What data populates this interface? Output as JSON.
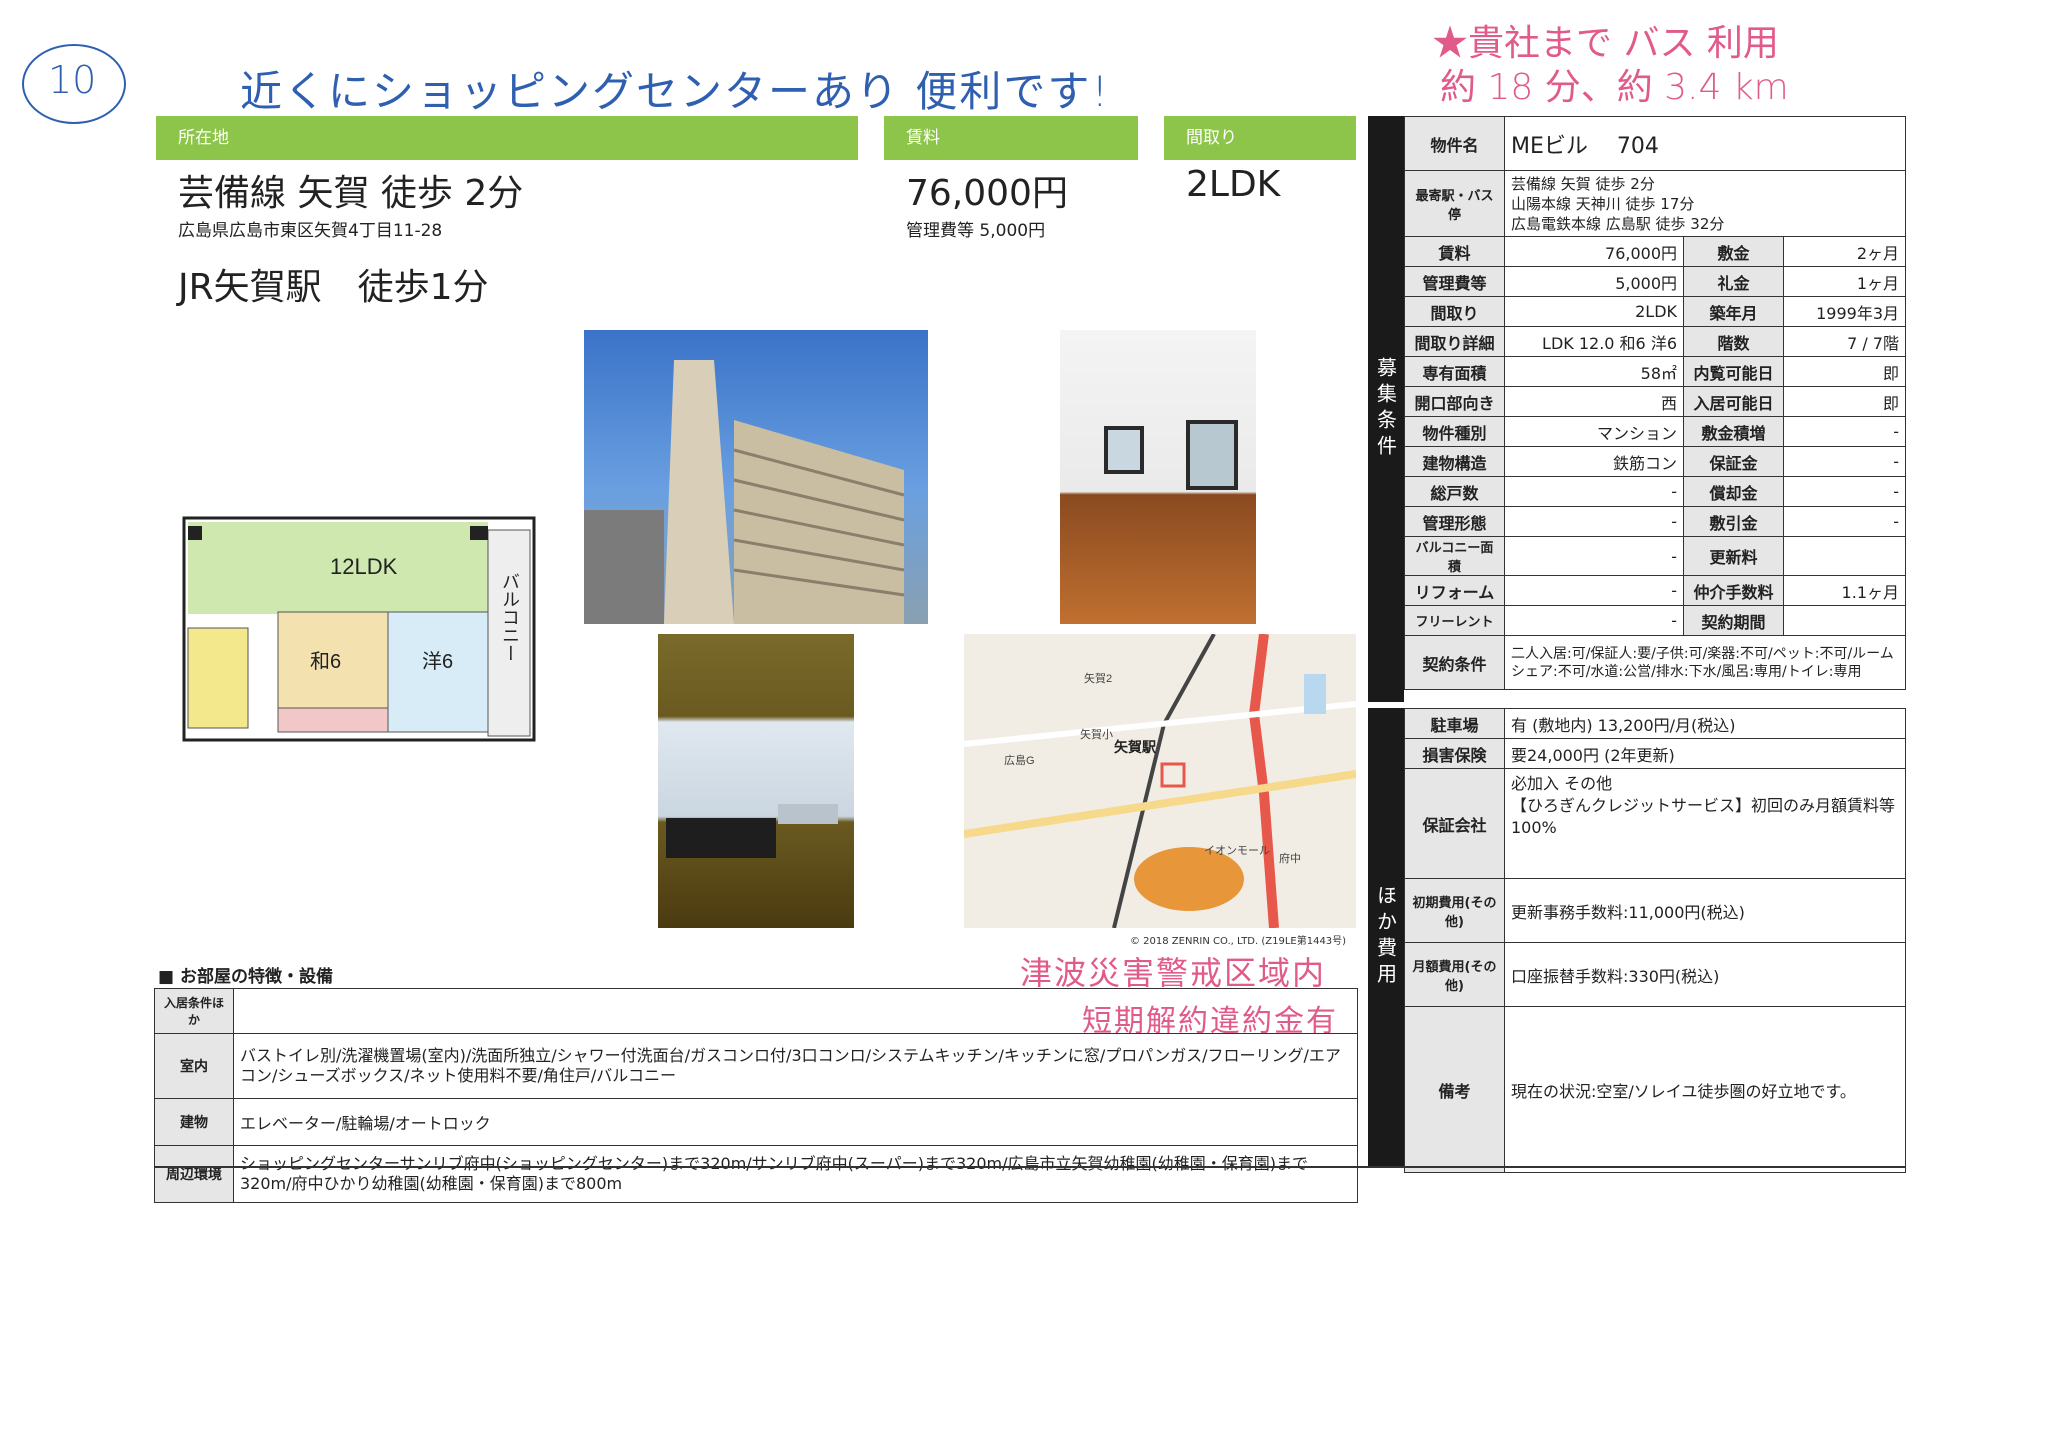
{
  "handwriting": {
    "number": "10",
    "note": "近くにショッピングセンターあり 便利です!",
    "bus_line1": "★貴社まで バス 利用",
    "bus_line2": "約 18 分、約 3.4 km"
  },
  "summary": {
    "location_header": "所在地",
    "location_main": "芸備線 矢賀 徒歩 2分",
    "address": "広島県広島市東区矢賀4丁目11-28",
    "station_note": "JR矢賀駅　徒歩1分",
    "rent_header": "賃料",
    "rent_main": "76,000円",
    "mgmt_fee": "管理費等 5,000円",
    "layout_header": "間取り",
    "layout_main": "2LDK"
  },
  "floorplan": {
    "ldk": "12LDK",
    "wa": "和6",
    "yo": "洋6",
    "balcony": "バルコニー"
  },
  "map": {
    "station": "矢賀駅",
    "labels": [
      "矢賀2",
      "矢賀小",
      "広島G",
      "イオンモール",
      "府中"
    ],
    "copyright": "© 2018 ZENRIN CO., LTD. (Z19LE第1443号)"
  },
  "spec": {
    "property_name_label": "物件名",
    "property_name": "MEビル　 704",
    "nearest_label": "最寄駅・バス停",
    "nearest": [
      "芸備線 矢賀 徒歩 2分",
      "山陽本線 天神川 徒歩 17分",
      "広島電鉄本線 広島駅 徒歩 32分"
    ],
    "rows": [
      {
        "l1": "賃料",
        "v1": "76,000円",
        "l2": "敷金",
        "v2": "2ヶ月"
      },
      {
        "l1": "管理費等",
        "v1": "5,000円",
        "l2": "礼金",
        "v2": "1ヶ月"
      },
      {
        "l1": "間取り",
        "v1": "2LDK",
        "l2": "築年月",
        "v2": "1999年3月"
      },
      {
        "l1": "間取り詳細",
        "v1": "LDK 12.0 和6 洋6",
        "l2": "階数",
        "v2": "7 / 7階"
      },
      {
        "l1": "専有面積",
        "v1": "58㎡",
        "l2": "内覧可能日",
        "v2": "即"
      },
      {
        "l1": "開口部向き",
        "v1": "西",
        "l2": "入居可能日",
        "v2": "即"
      },
      {
        "l1": "物件種別",
        "v1": "マンション",
        "l2": "敷金積増",
        "v2": "-"
      },
      {
        "l1": "建物構造",
        "v1": "鉄筋コン",
        "l2": "保証金",
        "v2": "-"
      },
      {
        "l1": "総戸数",
        "v1": "-",
        "l2": "償却金",
        "v2": "-"
      },
      {
        "l1": "管理形態",
        "v1": "-",
        "l2": "敷引金",
        "v2": "-"
      },
      {
        "l1": "バルコニー面積",
        "v1": "-",
        "l2": "更新料",
        "v2": ""
      },
      {
        "l1": "リフォーム",
        "v1": "-",
        "l2": "仲介手数料",
        "v2": "1.1ヶ月"
      },
      {
        "l1": "フリーレント",
        "v1": "-",
        "l2": "契約期間",
        "v2": ""
      }
    ],
    "contract_label": "契約条件",
    "contract": "二人入居:可/保証人:要/子供:可/楽器:不可/ペット:不可/ルームシェア:不可/水道:公営/排水:下水/風呂:専用/トイレ:専用",
    "side_label_1": "募集条件",
    "side_label_2": "ほか費用",
    "parking_label": "駐車場",
    "parking": "有 (敷地内) 13,200円/月(税込)",
    "insurance_label": "損害保険",
    "insurance": "要24,000円 (2年更新)",
    "guarantor_label": "保証会社",
    "guarantor": "必加入 その他\n【ひろぎんクレジットサービス】初回のみ月額賃料等100%",
    "initial_label": "初期費用(その他)",
    "initial": "更新事務手数料:11,000円(税込)",
    "monthly_label": "月額費用(その他)",
    "monthly": "口座振替手数料:330円(税込)",
    "remarks_label": "備考",
    "remarks": "現在の状況:空室/ソレイユ徒歩圏の好立地です。"
  },
  "features": {
    "title": "■ お部屋の特徴・設備",
    "stamp1": "津波災害警戒区域内",
    "stamp2": "短期解約違約金有",
    "rows": [
      {
        "label": "入居条件ほか",
        "value": ""
      },
      {
        "label": "室内",
        "value": "バストイレ別/洗濯機置場(室内)/洗面所独立/シャワー付洗面台/ガスコンロ付/3口コンロ/システムキッチン/キッチンに窓/プロパンガス/フローリング/エアコン/シューズボックス/ネット使用料不要/角住戸/バルコニー"
      },
      {
        "label": "建物",
        "value": "エレベーター/駐輪場/オートロック"
      },
      {
        "label": "周辺環境",
        "value": "ショッピングセンターサンリブ府中(ショッピングセンター)まで320m/サンリブ府中(スーパー)まで320m/広島市立矢賀幼稚園(幼稚園・保育園)まで320m/府中ひかり幼稚園(幼稚園・保育園)まで800m"
      }
    ]
  }
}
